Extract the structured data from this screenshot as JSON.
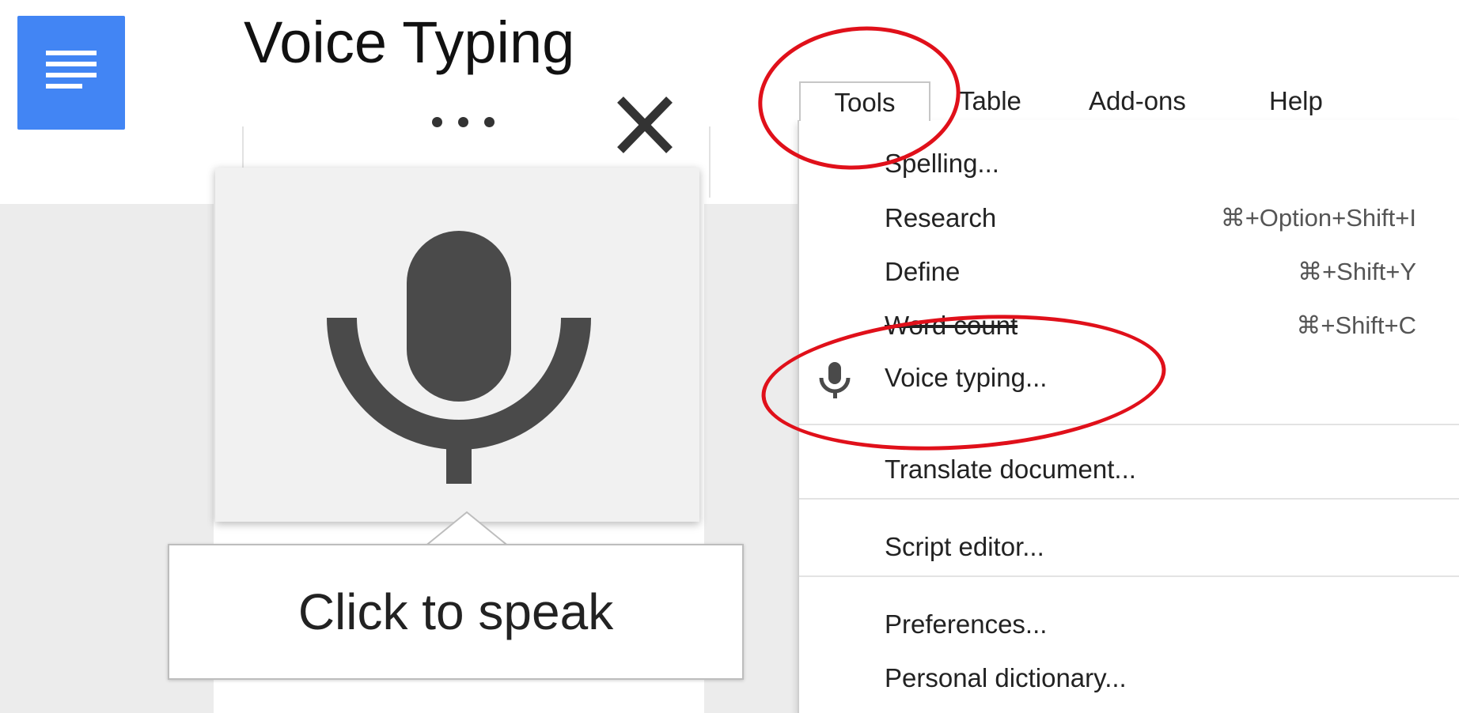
{
  "widget": {
    "title": "Voice Typing",
    "more_icon": "more-dots-icon",
    "close_icon": "close-icon",
    "mic_icon": "microphone-icon",
    "speak_prompt": "Click to speak"
  },
  "docs_icon": "google-docs-icon",
  "menubar": {
    "items": [
      {
        "label": "Tools",
        "active": true
      },
      {
        "label": "Table"
      },
      {
        "label": "Add-ons"
      },
      {
        "label": "Help"
      }
    ]
  },
  "tools_menu": {
    "items": [
      {
        "label": "Spelling..."
      },
      {
        "label": "Research",
        "shortcut": "⌘+Option+Shift+I"
      },
      {
        "label": "Define",
        "shortcut": "⌘+Shift+Y"
      },
      {
        "label": "Word count",
        "shortcut": "⌘+Shift+C"
      },
      {
        "label": "Voice typing...",
        "icon": "microphone-icon"
      },
      {
        "label": "Translate document..."
      },
      {
        "label": "Script editor..."
      },
      {
        "label": "Preferences..."
      },
      {
        "label": "Personal dictionary..."
      }
    ]
  },
  "colors": {
    "docs_blue": "#4285f4",
    "annotation_red": "#e0101a",
    "mic_gray": "#4a4a4a"
  }
}
